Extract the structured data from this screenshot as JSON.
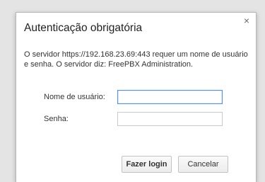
{
  "dialog": {
    "title": "Autenticação obrigatória",
    "close_label": "×",
    "message": "O servidor https://192.168.23.69:443 requer um nome de usuário e senha. O servidor diz: FreePBX Administration.",
    "username_label": "Nome de usuário:",
    "username_value": "",
    "password_label": "Senha:",
    "password_value": "",
    "login_label": "Fazer login",
    "cancel_label": "Cancelar"
  },
  "colors": {
    "focus_border": "#4d90fe",
    "backdrop": "#e4e4e4",
    "dialog_background": "#ffffff"
  }
}
